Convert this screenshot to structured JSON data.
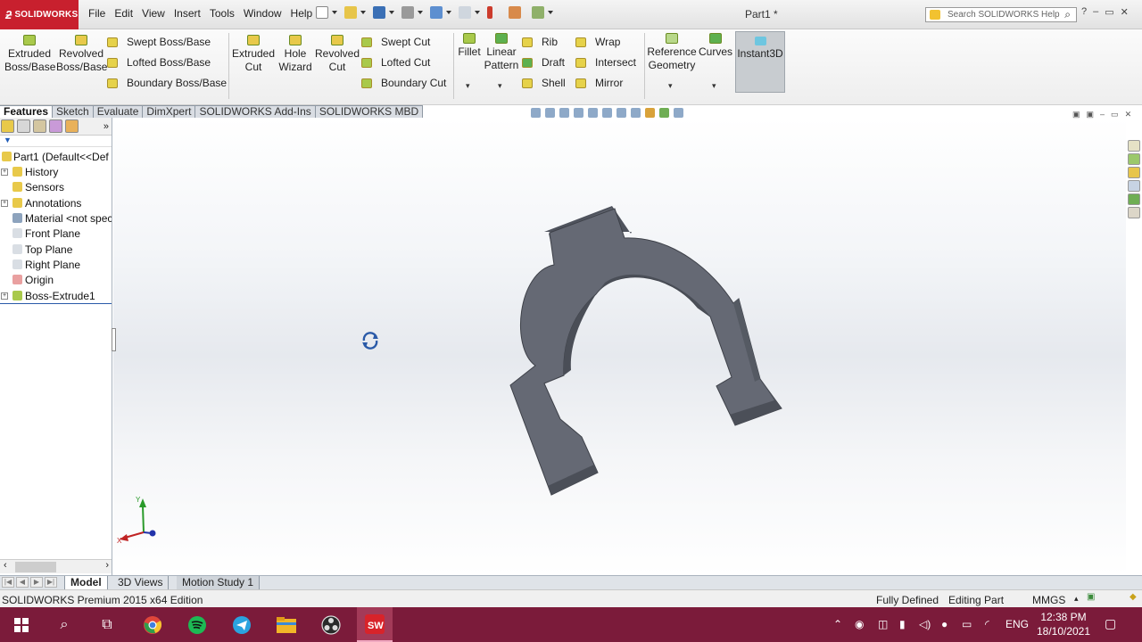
{
  "app": {
    "logo_text": "SOLIDWORKS",
    "menu": [
      "File",
      "Edit",
      "View",
      "Insert",
      "Tools",
      "Window",
      "Help"
    ],
    "document_title": "Part1 *",
    "search_placeholder": "Search SOLIDWORKS Help",
    "brand_color": "#c8202e"
  },
  "ribbon": {
    "extruded_boss": "Extruded\nBoss/Base",
    "revolved_boss": "Revolved\nBoss/Base",
    "swept_boss": "Swept Boss/Base",
    "lofted_boss": "Lofted Boss/Base",
    "boundary_boss": "Boundary Boss/Base",
    "extruded_cut": "Extruded\nCut",
    "hole_wizard": "Hole\nWizard",
    "revolved_cut": "Revolved\nCut",
    "swept_cut": "Swept Cut",
    "lofted_cut": "Lofted Cut",
    "boundary_cut": "Boundary Cut",
    "fillet": "Fillet",
    "linear_pattern": "Linear\nPattern",
    "rib": "Rib",
    "draft": "Draft",
    "shell": "Shell",
    "wrap": "Wrap",
    "intersect": "Intersect",
    "mirror": "Mirror",
    "reference_geometry": "Reference\nGeometry",
    "curves": "Curves",
    "instant3d": "Instant3D"
  },
  "command_tabs": [
    "Features",
    "Sketch",
    "Evaluate",
    "DimXpert",
    "SOLIDWORKS Add-Ins",
    "SOLIDWORKS MBD"
  ],
  "tree": {
    "root": "Part1  (Default<<Def",
    "items": [
      {
        "label": "History",
        "icon": "history-folder-icon"
      },
      {
        "label": "Sensors",
        "icon": "sensors-folder-icon"
      },
      {
        "label": "Annotations",
        "icon": "annotations-icon"
      },
      {
        "label": "Material <not spec",
        "icon": "material-icon"
      },
      {
        "label": "Front Plane",
        "icon": "plane-icon"
      },
      {
        "label": "Top Plane",
        "icon": "plane-icon"
      },
      {
        "label": "Right Plane",
        "icon": "plane-icon"
      },
      {
        "label": "Origin",
        "icon": "origin-icon"
      },
      {
        "label": "Boss-Extrude1",
        "icon": "boss-extrude-icon"
      }
    ]
  },
  "triad": {
    "y_label": "Y",
    "x_label": "X"
  },
  "bottom_tabs": [
    "Model",
    "3D Views",
    "Motion Study 1"
  ],
  "status": {
    "edition": "SOLIDWORKS Premium 2015 x64 Edition",
    "defined": "Fully Defined",
    "mode": "Editing Part",
    "units": "MMGS"
  },
  "taskbar": {
    "language": "ENG",
    "time": "12:38 PM",
    "date": "18/10/2021"
  }
}
